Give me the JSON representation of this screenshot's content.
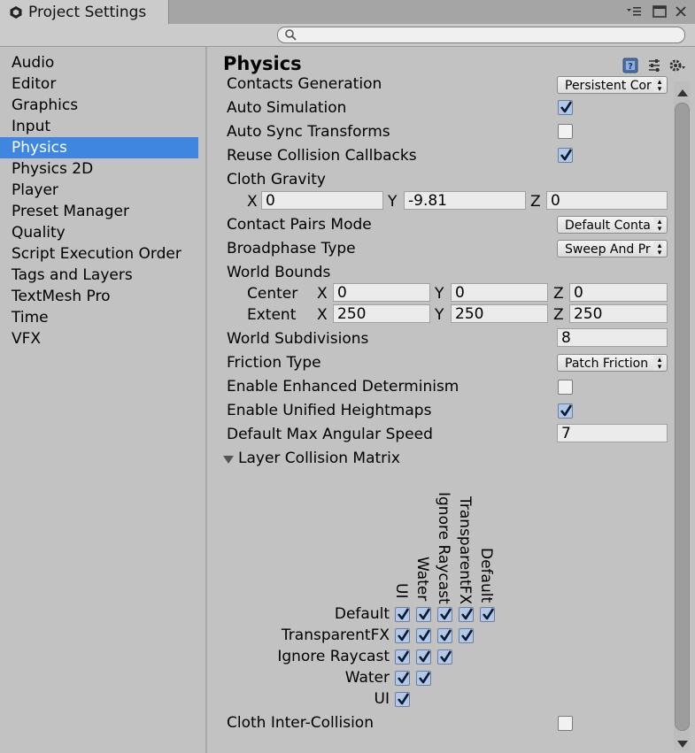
{
  "window": {
    "tab_title": "Project Settings",
    "icons": [
      "unity-logo-icon",
      "menu-icon",
      "maximize-icon",
      "close-icon"
    ]
  },
  "search": {
    "placeholder": "",
    "value": ""
  },
  "sidebar": {
    "items": [
      {
        "label": "Audio"
      },
      {
        "label": "Editor"
      },
      {
        "label": "Graphics"
      },
      {
        "label": "Input"
      },
      {
        "label": "Physics",
        "selected": true
      },
      {
        "label": "Physics 2D"
      },
      {
        "label": "Player"
      },
      {
        "label": "Preset Manager"
      },
      {
        "label": "Quality"
      },
      {
        "label": "Script Execution Order"
      },
      {
        "label": "Tags and Layers"
      },
      {
        "label": "TextMesh Pro"
      },
      {
        "label": "Time"
      },
      {
        "label": "VFX"
      }
    ],
    "selected_color": "#3f86e0"
  },
  "physics": {
    "title": "Physics",
    "header_icons": [
      "help-icon",
      "presets-icon",
      "gear-icon"
    ],
    "contacts_generation": {
      "label": "Contacts Generation",
      "value": "Persistent Cor"
    },
    "auto_simulation": {
      "label": "Auto Simulation",
      "checked": true
    },
    "auto_sync_transforms": {
      "label": "Auto Sync Transforms",
      "checked": false
    },
    "reuse_collision_callbacks": {
      "label": "Reuse Collision Callbacks",
      "checked": true
    },
    "cloth_gravity": {
      "label": "Cloth Gravity",
      "x_label": "X",
      "x": "0",
      "y_label": "Y",
      "y": "-9.81",
      "z_label": "Z",
      "z": "0"
    },
    "contact_pairs_mode": {
      "label": "Contact Pairs Mode",
      "value": "Default Conta"
    },
    "broadphase_type": {
      "label": "Broadphase Type",
      "value": "Sweep And Pr"
    },
    "world_bounds": {
      "label": "World Bounds",
      "center": {
        "label": "Center",
        "x_label": "X",
        "x": "0",
        "y_label": "Y",
        "y": "0",
        "z_label": "Z",
        "z": "0"
      },
      "extent": {
        "label": "Extent",
        "x_label": "X",
        "x": "250",
        "y_label": "Y",
        "y": "250",
        "z_label": "Z",
        "z": "250"
      }
    },
    "world_subdivisions": {
      "label": "World Subdivisions",
      "value": "8"
    },
    "friction_type": {
      "label": "Friction Type",
      "value": "Patch Friction"
    },
    "enhanced_determinism": {
      "label": "Enable Enhanced Determinism",
      "checked": false
    },
    "unified_heightmaps": {
      "label": "Enable Unified Heightmaps",
      "checked": true
    },
    "default_max_angular_speed": {
      "label": "Default Max Angular Speed",
      "value": "7"
    },
    "layer_matrix": {
      "label": "Layer Collision Matrix",
      "columns": [
        "UI",
        "Water",
        "Ignore Raycast",
        "TransparentFX",
        "Default"
      ],
      "rows": [
        {
          "label": "Default",
          "checks": [
            true,
            true,
            true,
            true,
            true
          ]
        },
        {
          "label": "TransparentFX",
          "checks": [
            true,
            true,
            true,
            true
          ]
        },
        {
          "label": "Ignore Raycast",
          "checks": [
            true,
            true,
            true
          ]
        },
        {
          "label": "Water",
          "checks": [
            true,
            true
          ]
        },
        {
          "label": "UI",
          "checks": [
            true
          ]
        }
      ]
    },
    "cloth_inter_collision": {
      "label": "Cloth Inter-Collision",
      "checked": false
    }
  }
}
